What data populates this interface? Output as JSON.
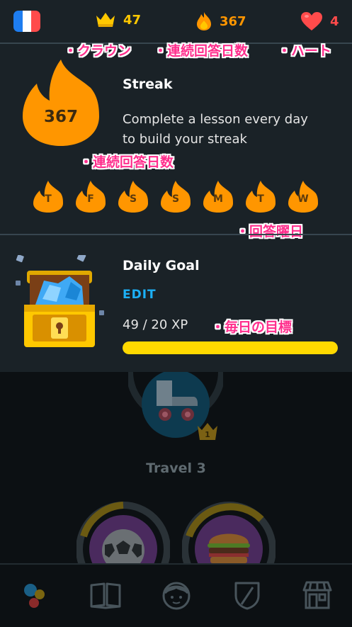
{
  "header": {
    "crowns": "47",
    "streak": "367",
    "hearts": "4"
  },
  "annotations": {
    "crown": "・クラウン",
    "streak": "・連続回答日数",
    "heart": "・ハート",
    "streak_count": "・連続回答日数",
    "answer_days": "・回答曜日",
    "daily_goal": "・毎日の目標"
  },
  "streak": {
    "title": "Streak",
    "count": "367",
    "desc_line1": "Complete a lesson every day",
    "desc_line2": "to build your streak",
    "days": [
      "T",
      "F",
      "S",
      "S",
      "M",
      "T",
      "W"
    ]
  },
  "daily_goal": {
    "title": "Daily Goal",
    "edit": "EDIT",
    "progress_text": "49 / 20 XP",
    "progress_fraction": 1.0
  },
  "course": {
    "skill_label": "Travel 3",
    "crown_level": "1"
  },
  "colors": {
    "crown": "#ffc800",
    "streak": "#ff9600",
    "heart": "#ff4b4b",
    "edit": "#1cb0f6",
    "progress": "#ffd900",
    "annotation": "#ff2d8c"
  },
  "nav": {
    "items": [
      "learn-icon",
      "stories-icon",
      "profile-icon",
      "leaderboard-icon",
      "shop-icon"
    ]
  }
}
